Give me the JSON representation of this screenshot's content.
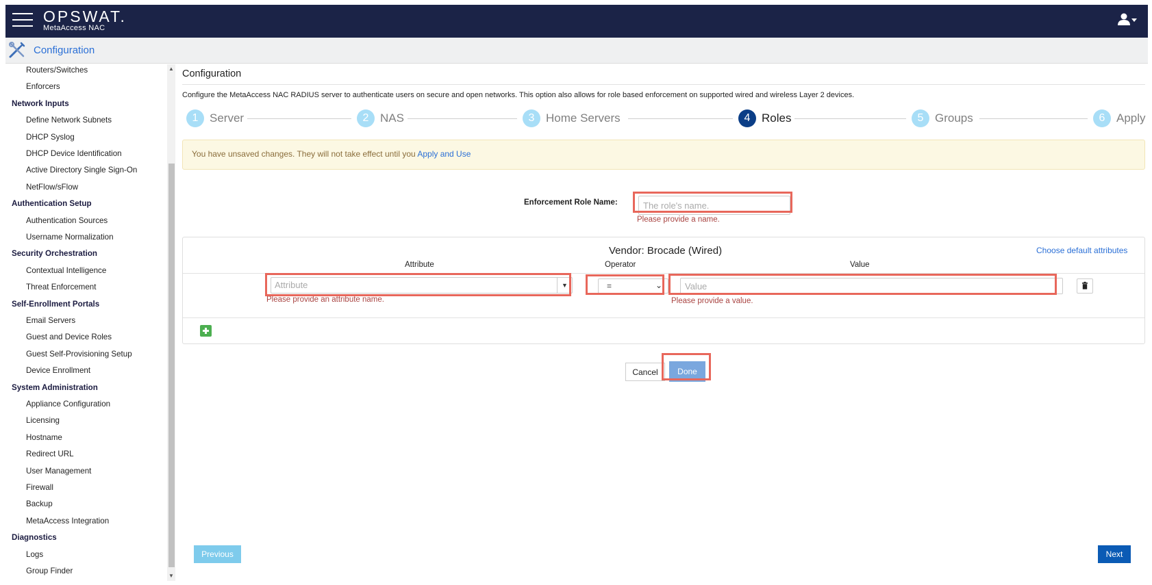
{
  "app": {
    "brand": "OPSWAT.",
    "product": "MetaAccess NAC"
  },
  "header": {
    "section_title": "Configuration"
  },
  "sidebar": {
    "items": [
      {
        "label": "Routers/Switches",
        "type": "sub"
      },
      {
        "label": "Enforcers",
        "type": "sub"
      },
      {
        "label": "Network Inputs",
        "type": "head"
      },
      {
        "label": "Define Network Subnets",
        "type": "sub"
      },
      {
        "label": "DHCP Syslog",
        "type": "sub"
      },
      {
        "label": "DHCP Device Identification",
        "type": "sub"
      },
      {
        "label": "Active Directory Single Sign-On",
        "type": "sub"
      },
      {
        "label": "NetFlow/sFlow",
        "type": "sub"
      },
      {
        "label": "Authentication Setup",
        "type": "head"
      },
      {
        "label": "Authentication Sources",
        "type": "sub"
      },
      {
        "label": "Username Normalization",
        "type": "sub"
      },
      {
        "label": "Security Orchestration",
        "type": "head"
      },
      {
        "label": "Contextual Intelligence",
        "type": "sub"
      },
      {
        "label": "Threat Enforcement",
        "type": "sub"
      },
      {
        "label": "Self-Enrollment Portals",
        "type": "head"
      },
      {
        "label": "Email Servers",
        "type": "sub"
      },
      {
        "label": "Guest and Device Roles",
        "type": "sub"
      },
      {
        "label": "Guest Self-Provisioning Setup",
        "type": "sub"
      },
      {
        "label": "Device Enrollment",
        "type": "sub"
      },
      {
        "label": "System Administration",
        "type": "head"
      },
      {
        "label": "Appliance Configuration",
        "type": "sub"
      },
      {
        "label": "Licensing",
        "type": "sub"
      },
      {
        "label": "Hostname",
        "type": "sub"
      },
      {
        "label": "Redirect URL",
        "type": "sub"
      },
      {
        "label": "User Management",
        "type": "sub"
      },
      {
        "label": "Firewall",
        "type": "sub"
      },
      {
        "label": "Backup",
        "type": "sub"
      },
      {
        "label": "MetaAccess Integration",
        "type": "sub"
      },
      {
        "label": "Diagnostics",
        "type": "head"
      },
      {
        "label": "Logs",
        "type": "sub"
      },
      {
        "label": "Group Finder",
        "type": "sub"
      }
    ]
  },
  "main": {
    "title": "Configuration",
    "description": "Configure the MetaAccess NAC RADIUS server to authenticate users on secure and open networks. This option also allows for role based enforcement on supported wired and wireless Layer 2 devices.",
    "steps": [
      {
        "num": "1",
        "label": "Server"
      },
      {
        "num": "2",
        "label": "NAS"
      },
      {
        "num": "3",
        "label": "Home Servers"
      },
      {
        "num": "4",
        "label": "Roles",
        "active": true
      },
      {
        "num": "5",
        "label": "Groups"
      },
      {
        "num": "6",
        "label": "Apply"
      }
    ],
    "alert": {
      "text": "You have unsaved changes. They will not take effect until you ",
      "link": "Apply and Use"
    },
    "role_name": {
      "label": "Enforcement Role Name:",
      "placeholder": "The role's name.",
      "value": "",
      "error": "Please provide a name."
    },
    "vendor_panel": {
      "vendor_title": "Vendor: Brocade (Wired)",
      "choose_defaults": "Choose default attributes",
      "col_attribute": "Attribute",
      "col_operator": "Operator",
      "col_value": "Value",
      "attribute_placeholder": "Attribute",
      "attribute_error": "Please provide an attribute name.",
      "operator_value": "=",
      "value_placeholder": "Value",
      "value_error": "Please provide a value."
    },
    "buttons": {
      "cancel": "Cancel",
      "done": "Done",
      "previous": "Previous",
      "next": "Next"
    }
  },
  "colors": {
    "topbar": "#1b2347",
    "accent": "#2a6fd6",
    "step_active": "#0b3e87",
    "step_inactive": "#a8def7",
    "error": "#a94442",
    "highlight": "#e8675b"
  }
}
